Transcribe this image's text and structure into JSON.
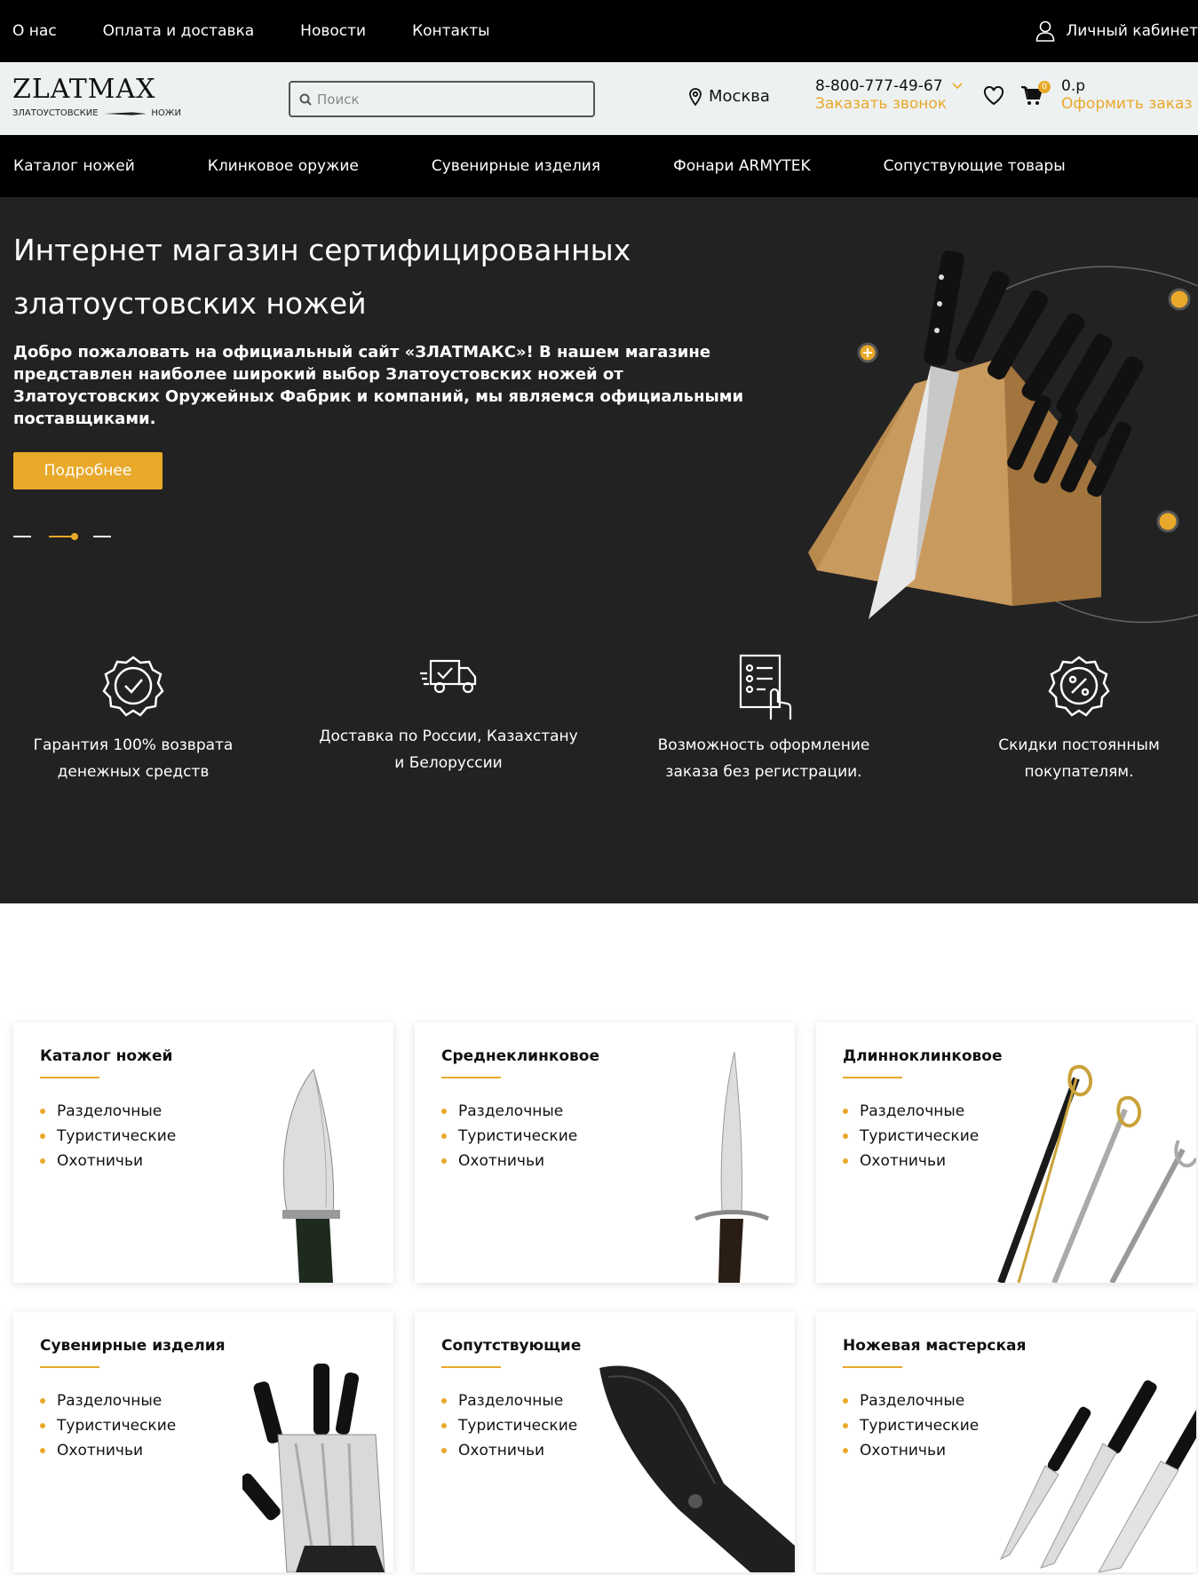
{
  "topbar": {
    "nav": [
      "О нас",
      "Оплата и доставка",
      "Новости",
      "Контакты"
    ],
    "account_label": "Личный кабинет"
  },
  "header": {
    "logo_word": "ZLATMAX",
    "logo_left": "ЗЛАТОУСТОВСКИЕ",
    "logo_right": "НОЖИ",
    "search_placeholder": "Поиск",
    "city": "Москва",
    "phone": "8-800-777-49-67",
    "callback": "Заказать звонок",
    "cart_count": "0",
    "cart_sum": "0.р",
    "checkout": "Оформить заказ"
  },
  "catnav": [
    "Каталог ножей",
    "Клинковое оружие",
    "Сувенирные изделия",
    "Фонари ARMYTEK",
    "Сопуствующие товары"
  ],
  "hero": {
    "title": "Интернет магазин сертифицированных златоустовских ножей",
    "description": "Добро пожаловать на официальный сайт «ЗЛАТМАКС»! В нашем магазине представлен наиболее широкий выбор Златоустовских ножей от Златоустовских Оружейных Фабрик и компаний, мы являемся официальными поставщиками.",
    "button": "Подробнее",
    "slides": 3,
    "active_slide": 2
  },
  "features": [
    {
      "icon": "guarantee-check-icon",
      "text": "Гарантия 100% возврата денежных средств"
    },
    {
      "icon": "delivery-truck-icon",
      "text": "Доставка по России, Казахстану и Белоруссии"
    },
    {
      "icon": "order-form-icon",
      "text": "Возможность оформление заказа без регистрации."
    },
    {
      "icon": "discount-percent-icon",
      "text": "Скидки постоянным покупателям."
    }
  ],
  "categories": [
    {
      "title": "Каталог ножей",
      "items": [
        "Разделочные",
        "Туристические",
        "Охотничьи"
      ]
    },
    {
      "title": "Среднеклинковое",
      "items": [
        "Разделочные",
        "Туристические",
        "Охотничьи"
      ]
    },
    {
      "title": "Длинноклинковое",
      "items": [
        "Разделочные",
        "Туристические",
        "Охотничьи"
      ]
    },
    {
      "title": "Сувенирные изделия",
      "items": [
        "Разделочные",
        "Туристические",
        "Охотничьи"
      ]
    },
    {
      "title": "Сопутствующие",
      "items": [
        "Разделочные",
        "Туристические",
        "Охотничьи"
      ]
    },
    {
      "title": "Ножевая мастерская",
      "items": [
        "Разделочные",
        "Туристические",
        "Охотничьи"
      ]
    }
  ],
  "colors": {
    "accent": "#e8a92a",
    "dark": "#222222",
    "black": "#000000",
    "header_bg": "#eef1f1"
  }
}
